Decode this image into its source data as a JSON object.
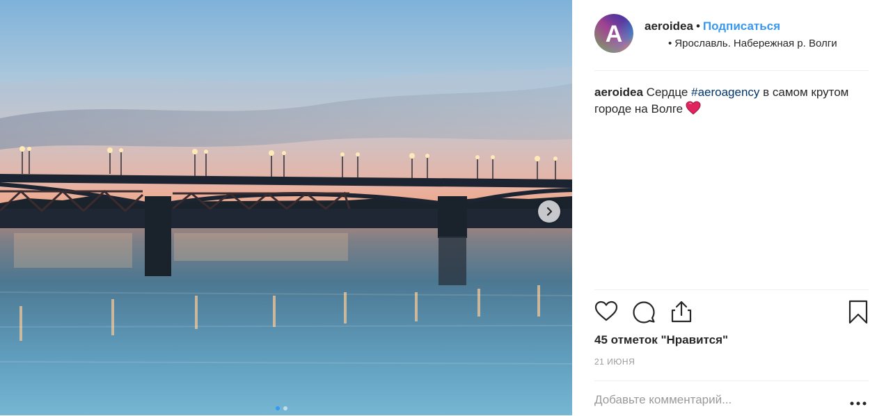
{
  "post": {
    "username": "aeroidea",
    "separator": "•",
    "follow_label": "Подписаться",
    "location_bullet": "•",
    "location": "Ярославль. Набережная р. Волги",
    "avatar_letter": "A"
  },
  "caption": {
    "username": "aeroidea",
    "text_before": " Сердце ",
    "hashtag": "#aeroagency",
    "text_after": " в самом крутом городе на Волге"
  },
  "stats": {
    "likes_label": "45 отметок \"Нравится\"",
    "date_label": "21 ИЮНЯ"
  },
  "comment": {
    "placeholder": "Добавьте комментарий..."
  },
  "carousel": {
    "total_slides": 2,
    "active_slide": 1
  },
  "colors": {
    "accent": "#3897f0",
    "hashtag": "#003569",
    "text": "#262626",
    "muted": "#999999",
    "heart": "#e0245e"
  },
  "icons": {
    "like": "heart-icon",
    "comment": "comment-icon",
    "share": "share-icon",
    "save": "bookmark-icon",
    "next": "chevron-right-icon",
    "more": "more-dots-icon"
  }
}
